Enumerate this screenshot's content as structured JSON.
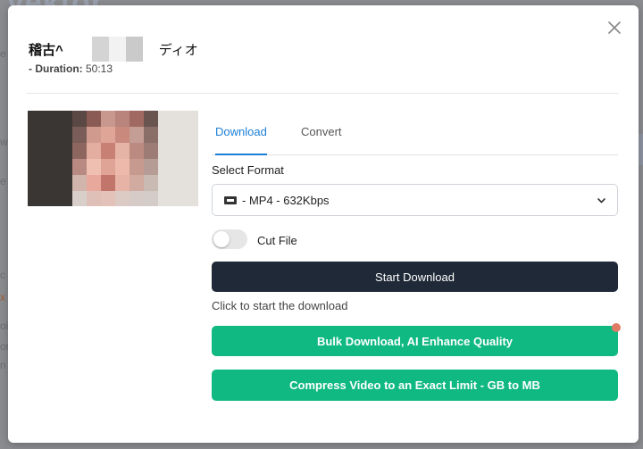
{
  "backdrop": {
    "logo_text": "Vektor",
    "side_letters": [
      "e",
      "w",
      "e",
      "c",
      "x",
      "oi",
      "or",
      "n"
    ]
  },
  "modal": {
    "title_left": "稽古^",
    "title_right": "ディオ",
    "duration_label": "- Duration:",
    "duration_value": "50:13",
    "close_icon": "close-icon"
  },
  "tabs": [
    {
      "label": "Download",
      "active": true
    },
    {
      "label": "Convert",
      "active": false
    }
  ],
  "format": {
    "label": "Select Format",
    "selected": "- MP4 - 632Kbps",
    "icon": "film-icon"
  },
  "cut_file": {
    "label": "Cut File",
    "enabled": false
  },
  "buttons": {
    "start": "Start Download",
    "hint": "Click to start the download",
    "bulk": "Bulk Download, AI Enhance Quality",
    "compress": "Compress Video to an Exact Limit - GB to MB"
  },
  "colors": {
    "accent_blue": "#1c7fd6",
    "dark_button": "#1f2937",
    "green_button": "#10b981",
    "notification_dot": "#e07b66"
  }
}
